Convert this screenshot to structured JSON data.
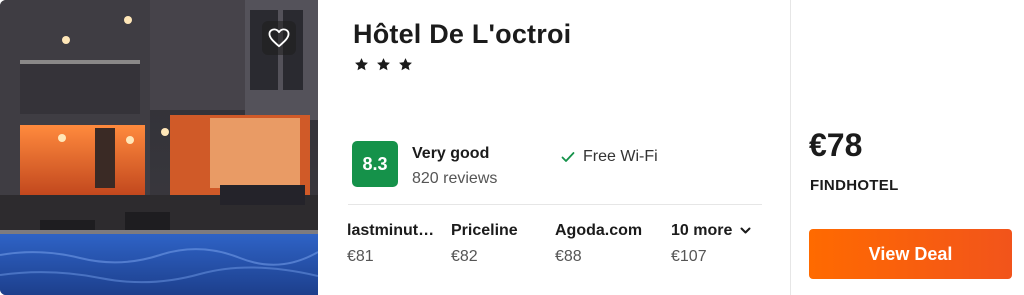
{
  "hotel": {
    "name": "Hôtel De L'octroi",
    "stars": 3,
    "rating_score": "8.3",
    "rating_text": "Very good",
    "reviews": "820 reviews",
    "amenity": "Free Wi-Fi"
  },
  "providers": [
    {
      "name": "lastminut…",
      "price": "€81"
    },
    {
      "name": "Priceline",
      "price": "€82"
    },
    {
      "name": "Agoda.com",
      "price": "€88"
    }
  ],
  "more": {
    "label": "10 more",
    "price": "€107"
  },
  "deal": {
    "price": "€78",
    "provider": "FINDHOTEL",
    "button_label": "View Deal"
  },
  "colors": {
    "rating_badge": "#15924a",
    "deal_button": "#ff5a0a",
    "check": "#15924a"
  },
  "icons": {
    "favorite": "heart-icon",
    "star": "star-icon",
    "amenity": "check-icon",
    "more": "chevron-down-icon"
  }
}
